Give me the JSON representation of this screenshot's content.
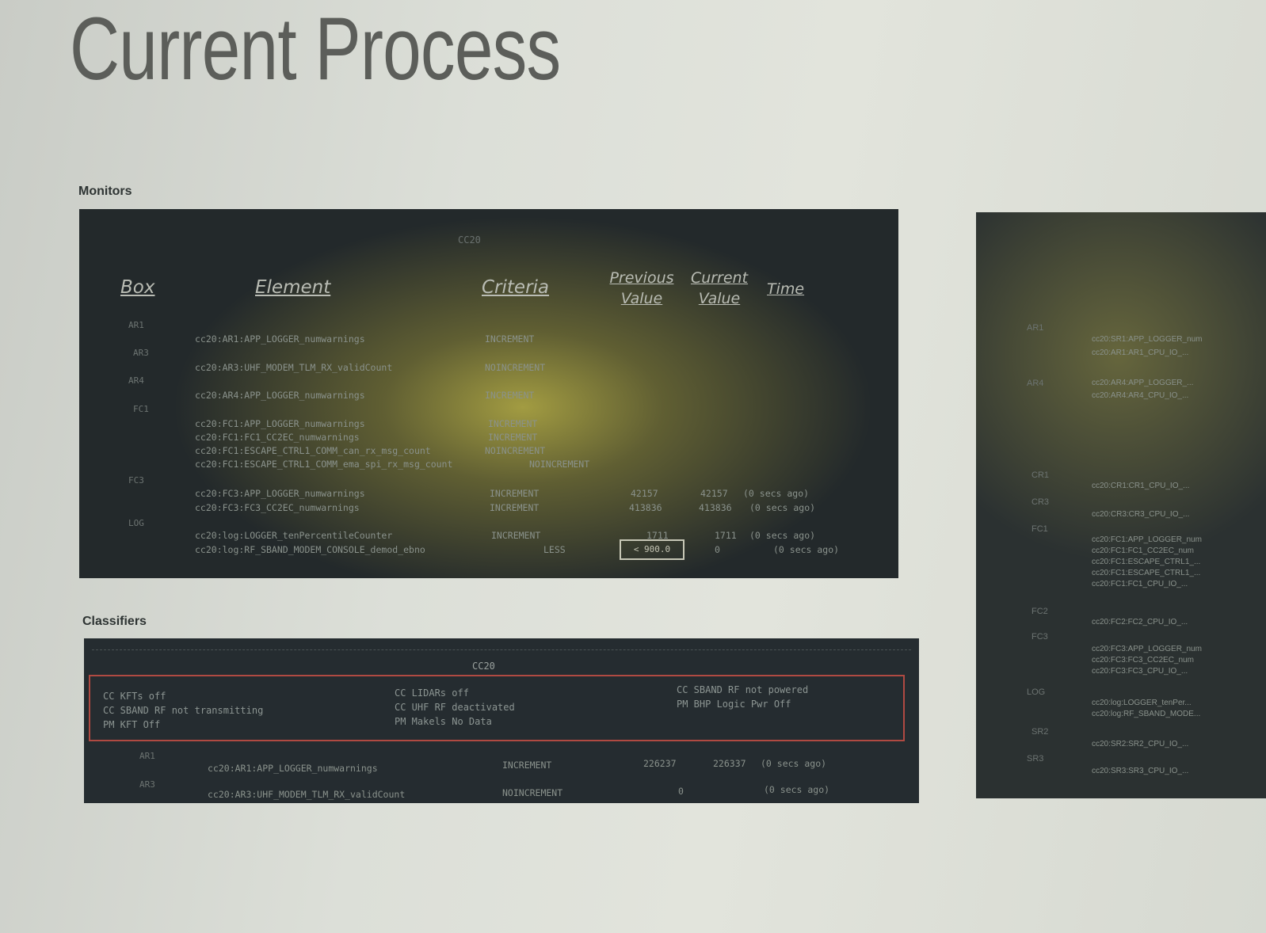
{
  "page": {
    "title": "Current Process",
    "monitors_label": "Monitors",
    "classifiers_label": "Classifiers"
  },
  "monitors": {
    "header_text": "CC20",
    "columns": {
      "box": "Box",
      "element": "Element",
      "criteria": "Criteria",
      "previous_value": "Previous Value",
      "current_value": "Current Value",
      "time": "Time"
    },
    "groups": [
      "AR1",
      "AR3",
      "AR4",
      "FC1",
      "FC3",
      "LOG"
    ],
    "rows": [
      {
        "element": "cc20:AR1:APP_LOGGER_numwarnings",
        "criteria": "INCREMENT"
      },
      {
        "element": "cc20:AR3:UHF_MODEM_TLM_RX_validCount",
        "criteria": "NOINCREMENT"
      },
      {
        "element": "cc20:AR4:APP_LOGGER_numwarnings",
        "criteria": "INCREMENT"
      },
      {
        "element": "cc20:FC1:APP_LOGGER_numwarnings",
        "criteria": "INCREMENT"
      },
      {
        "element": "cc20:FC1:FC1_CC2EC_numwarnings",
        "criteria": "INCREMENT"
      },
      {
        "element": "cc20:FC1:ESCAPE_CTRL1_COMM_can_rx_msg_count",
        "criteria": "NOINCREMENT"
      },
      {
        "element": "cc20:FC1:ESCAPE_CTRL1_COMM_ema_spi_rx_msg_count",
        "criteria": "NOINCREMENT"
      },
      {
        "element": "cc20:FC3:APP_LOGGER_numwarnings",
        "criteria": "INCREMENT",
        "previous": "42157",
        "current": "42157",
        "time": "(0 secs ago)"
      },
      {
        "element": "cc20:FC3:FC3_CC2EC_numwarnings",
        "criteria": "INCREMENT",
        "previous": "413836",
        "current": "413836",
        "time": "(0 secs ago)"
      },
      {
        "element": "cc20:log:LOGGER_tenPercentileCounter",
        "criteria": "INCREMENT",
        "previous": "1711",
        "current": "1711",
        "time": "(0 secs ago)"
      },
      {
        "element": "cc20:log:RF_SBAND_MODEM_CONSOLE_demod_ebno",
        "criteria": "LESS",
        "previous": "< 900.0",
        "current": "0",
        "time": "(0 secs ago)"
      }
    ]
  },
  "classifiers": {
    "header_text": "CC20",
    "col1": [
      "CC KFTs off",
      "CC SBAND RF not transmitting",
      "PM KFT Off"
    ],
    "col2": [
      "CC LIDARs off",
      "CC UHF RF deactivated",
      "PM Makels No Data"
    ],
    "col3": [
      "CC SBAND RF not powered",
      "PM BHP Logic Pwr Off"
    ],
    "groups": [
      "AR1",
      "AR3"
    ],
    "rows": [
      {
        "element": "cc20:AR1:APP_LOGGER_numwarnings",
        "criteria": "INCREMENT",
        "previous": "226237",
        "current": "226337",
        "time": "(0 secs ago)"
      },
      {
        "element": "cc20:AR3:UHF_MODEM_TLM_RX_validCount",
        "criteria": "NOINCREMENT",
        "previous": "0",
        "time": "(0 secs ago)"
      }
    ]
  },
  "side_panel": {
    "groups": [
      "AR1",
      "AR4",
      "CR1",
      "CR3",
      "FC1",
      "FC2",
      "FC3",
      "LOG",
      "SR2",
      "SR3"
    ],
    "rows": [
      "cc20:SR1:APP_LOGGER_num",
      "cc20:AR1:AR1_CPU_IO_...",
      "cc20:AR4:APP_LOGGER_...",
      "cc20:AR4:AR4_CPU_IO_...",
      "cc20:CR1:CR1_CPU_IO_...",
      "cc20:CR3:CR3_CPU_IO_...",
      "cc20:FC1:APP_LOGGER_num",
      "cc20:FC1:FC1_CC2EC_num",
      "cc20:FC1:ESCAPE_CTRL1_...",
      "cc20:FC1:ESCAPE_CTRL1_...",
      "cc20:FC1:FC1_CPU_IO_...",
      "cc20:FC2:FC2_CPU_IO_...",
      "cc20:FC3:APP_LOGGER_num",
      "cc20:FC3:FC3_CC2EC_num",
      "cc20:FC3:FC3_CPU_IO_...",
      "cc20:log:LOGGER_tenPer...",
      "cc20:log:RF_SBAND_MODE...",
      "cc20:SR2:SR2_CPU_IO_...",
      "cc20:SR3:SR3_CPU_IO_..."
    ]
  }
}
